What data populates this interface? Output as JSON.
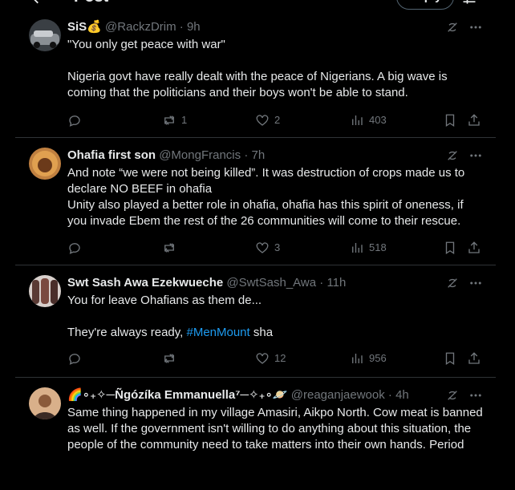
{
  "header": {
    "title": "Post",
    "reply_label": "Reply"
  },
  "posts": [
    {
      "name": "SiS",
      "name_suffix": "💰",
      "handle": "@RackzDrim",
      "time": "9h",
      "text": "\"You only get peace with war\"\n\nNigeria govt have really dealt with the peace of Nigerians. A big wave is coming that the politicians and their boys won't be able to stand.",
      "reposts": "1",
      "likes": "2",
      "views": "403",
      "avatar_color": "#4a4f55"
    },
    {
      "name": "Ohafia first son",
      "handle": "@MongFrancis",
      "time": "7h",
      "text": "And note “we were not being killed”. It was destruction of crops made us to declare NO BEEF in ohafia\nUnity also played a better role in ohafia, ohafia has this spirit of oneness, if you invade Ebem the rest of the 26 communities will come to their rescue.",
      "reposts": "",
      "likes": "3",
      "views": "518",
      "avatar_color": "#b07030"
    },
    {
      "name": "Swt Sash Awa Ezekwueche",
      "handle": "@SwtSash_Awa",
      "time": "11h",
      "text_line1": "You for leave Ohafians as them de...",
      "text_line2_pre": "They're always ready, ",
      "text_link": "#MenMount",
      "text_line2_post": " sha",
      "reposts": "",
      "likes": "12",
      "views": "956",
      "avatar_color": "#6b4a44"
    },
    {
      "name": "🌈∘₊✧─Ñgózíka Emmanuella⁷─✧₊∘🪐",
      "handle": "@reaganjaewook",
      "time": "4h",
      "text": "Same thing happened in my village Amasiri, Aikpo North. Cow meat is banned as well. If the government isn't willing to do anything about this situation, the people of the community need to take matters into their own hands. Period",
      "avatar_color": "#c8a07a"
    }
  ],
  "colors": {
    "background": "#000000",
    "text": "#e7e9ea",
    "muted": "#71767b",
    "link": "#1d9bf0",
    "divider": "#2f3336"
  },
  "icons": [
    "back-arrow-icon",
    "filter-icon",
    "grok-icon",
    "more-icon",
    "reply-icon",
    "repost-icon",
    "like-icon",
    "views-icon",
    "bookmark-icon",
    "share-icon"
  ]
}
